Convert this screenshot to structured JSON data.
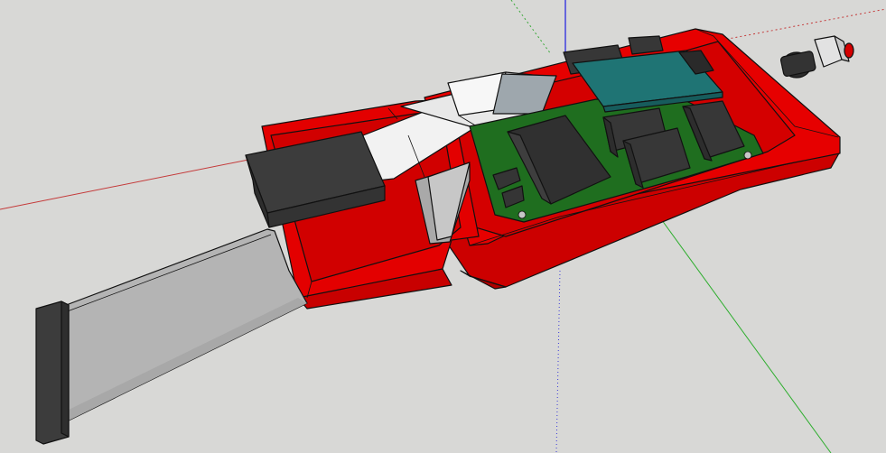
{
  "scene": {
    "background_color": "#d8d8d6",
    "axes": {
      "x_color": "#c43a3a",
      "y_color": "#3aa83a",
      "z_color": "#3a3ad8"
    },
    "enclosure_color": "#e00000",
    "pcb_color": "#1d6e1d",
    "module_color": "#1d7070",
    "component_color": "#3a3a3a",
    "ribbon_cable_color": "#b0b0b0",
    "flex_cable_color": "#f2f2f2",
    "icons": [
      "red-enclosure",
      "ribbon-cable",
      "flex-cable",
      "pcb-board",
      "push-button"
    ]
  }
}
